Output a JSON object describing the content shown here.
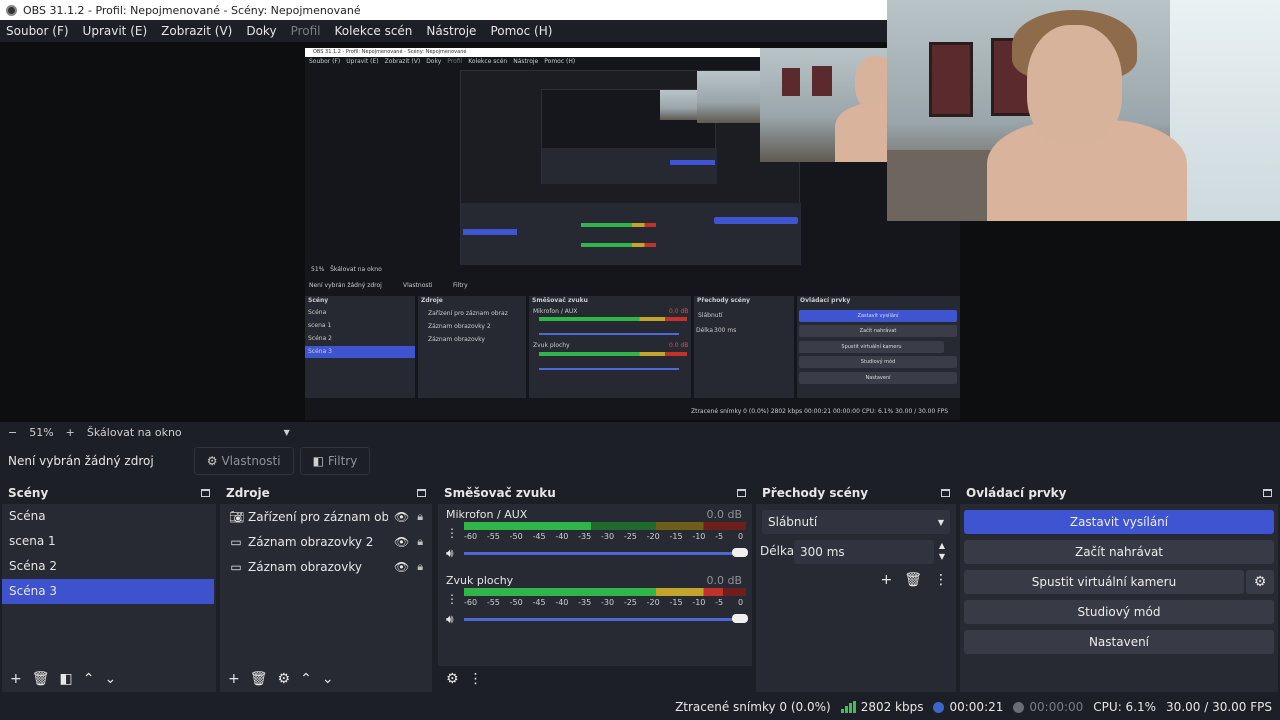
{
  "window": {
    "title": "OBS 31.1.2 - Profil: Nepojmenované - Scény: Nepojmenované"
  },
  "menu": [
    {
      "label": "Soubor (F)",
      "disabled": false
    },
    {
      "label": "Upravit (E)",
      "disabled": false
    },
    {
      "label": "Zobrazit (V)",
      "disabled": false
    },
    {
      "label": "Doky",
      "disabled": false
    },
    {
      "label": "Profil",
      "disabled": true
    },
    {
      "label": "Kolekce scén",
      "disabled": false
    },
    {
      "label": "Nástroje",
      "disabled": false
    },
    {
      "label": "Pomoc (H)",
      "disabled": false
    }
  ],
  "preview": {
    "zoom_minus": "−",
    "zoom_value": "51%",
    "zoom_plus": "+",
    "scale_mode": "Škálovat na okno"
  },
  "source_toolbar": {
    "no_source": "Není vybrán žádný zdroj",
    "properties": "Vlastnosti",
    "filters": "Filtry"
  },
  "scenes": {
    "title": "Scény",
    "items": [
      "Scéna",
      "scena 1",
      "Scéna 2",
      "Scéna 3"
    ],
    "selected_index": 3
  },
  "sources": {
    "title": "Zdroje",
    "items": [
      {
        "name": "Zařízení pro záznam obrazu",
        "icon": "camera-icon"
      },
      {
        "name": "Záznam obrazovky 2",
        "icon": "monitor-icon"
      },
      {
        "name": "Záznam obrazovky",
        "icon": "monitor-icon"
      }
    ]
  },
  "mixer": {
    "title": "Směšovač zvuku",
    "channels": [
      {
        "name": "Mikrofon / AUX",
        "db": "0.0 dB",
        "level": 0.45
      },
      {
        "name": "Zvuk plochy",
        "db": "0.0 dB",
        "level": 0.92
      }
    ],
    "ticks": [
      "-60",
      "-55",
      "-50",
      "-45",
      "-40",
      "-35",
      "-30",
      "-25",
      "-20",
      "-15",
      "-10",
      "-5",
      "0"
    ]
  },
  "transitions": {
    "title": "Přechody scény",
    "selected": "Slábnutí",
    "duration_label": "Délka",
    "duration_value": "300 ms"
  },
  "controls": {
    "title": "Ovládací prvky",
    "buttons": [
      "Zastavit vysílání",
      "Začít nahrávat",
      "Spustit virtuální kameru",
      "Studiový mód",
      "Nastavení"
    ]
  },
  "status": {
    "dropped": "Ztracené snímky 0 (0.0%)",
    "bitrate": "2802 kbps",
    "stream_time": "00:00:21",
    "rec_time": "00:00:00",
    "cpu": "CPU: 6.1%",
    "fps": "30.00 / 30.00 FPS"
  },
  "nested_preview": {
    "title": "OBS 31.1.2 - Profil: Nepojmenované - Scény: Nepojmenované",
    "menu": [
      "Soubor (F)",
      "Upravit (E)",
      "Zobrazit (V)",
      "Doky",
      "Profil",
      "Kolekce scén",
      "Nástroje",
      "Pomoc (H)"
    ],
    "zoom": "51%",
    "scale": "Škálovat na okno",
    "no_source": "Není vybrán žádný zdroj",
    "properties": "Vlastnosti",
    "filters": "Filtry",
    "scenes_title": "Scény",
    "scenes": [
      "Scéna",
      "scena 1",
      "Scéna 2",
      "Scéna 3"
    ],
    "sources_title": "Zdroje",
    "sources": [
      "Zařízení pro záznam obraz",
      "Záznam obrazovky 2",
      "Záznam obrazovky"
    ],
    "mixer_title": "Směšovač zvuku",
    "mic": "Mikrofon / AUX",
    "desktop": "Zvuk plochy",
    "db": "0.0 dB",
    "transitions_title": "Přechody scény",
    "transition": "Slábnutí",
    "duration_label": "Délka",
    "duration": "300 ms",
    "controls_title": "Ovládací prvky",
    "buttons": [
      "Zastavit vysílání",
      "Začít nahrávat",
      "Spustit virtuální kameru",
      "Studiový mód",
      "Nastavení"
    ],
    "status": "Ztracené snímky 0 (0.0%)",
    "bitrate": "2802 kbps",
    "time": "00:00:21",
    "time2": "00:00:00",
    "cpu": "CPU: 6.1%",
    "fps": "30.00 / 30.00 FPS"
  },
  "colors": {
    "accent": "#3f54d1",
    "panel": "#272a33",
    "background": "#1d1f26",
    "meter_green": "#2fb54a",
    "meter_yellow": "#c2a52c",
    "meter_red": "#c2322c"
  }
}
